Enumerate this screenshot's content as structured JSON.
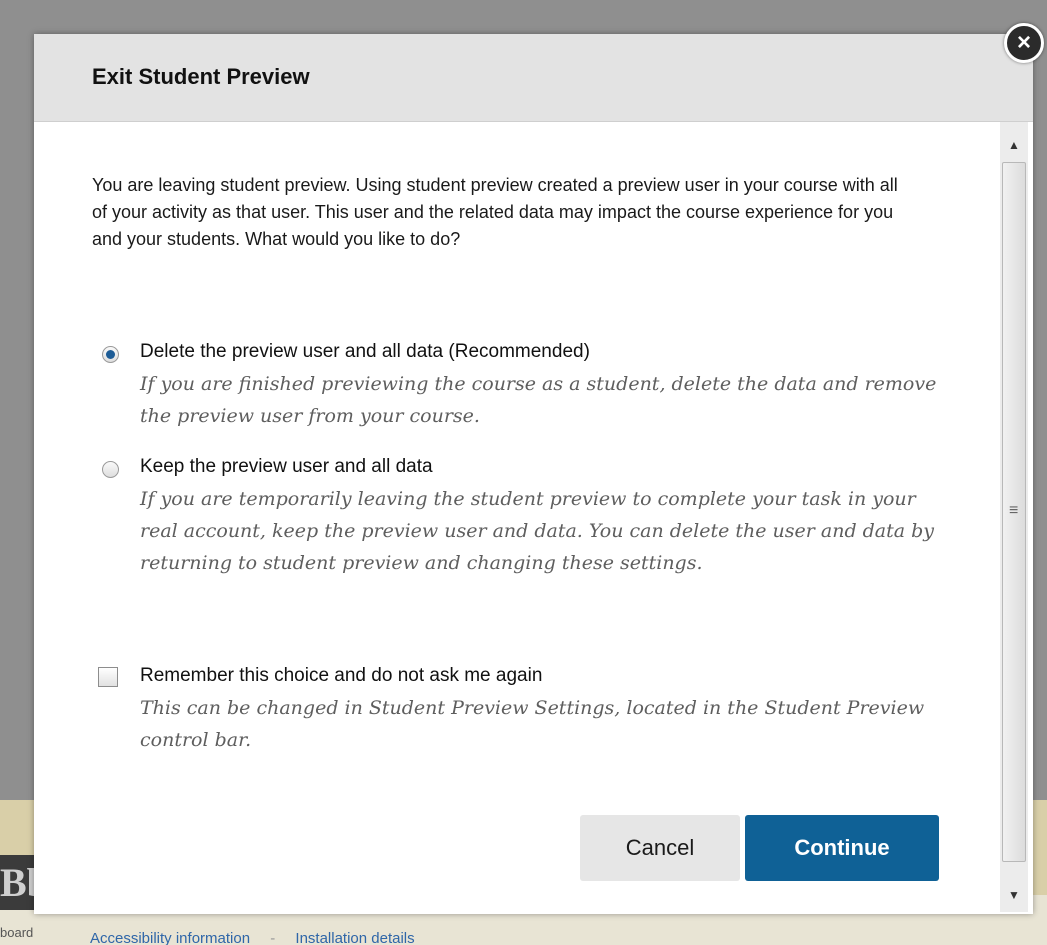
{
  "background": {
    "footer_logo": "Bb",
    "footer_left_text": "board",
    "footer_links": [
      "Accessibility information",
      "Installation details"
    ]
  },
  "dialog": {
    "title": "Exit Student Preview",
    "close_icon": "close-icon",
    "intro": "You are leaving student preview. Using student preview created a preview user in your course with all of your activity as that user. This user and the related data may impact the course experience for you and your students. What would you like to do?",
    "options": [
      {
        "label": "Delete the preview user and all data (Recommended)",
        "description": "If you are finished previewing the course as a student, delete the data and remove the preview user from your course.",
        "selected": true
      },
      {
        "label": "Keep the preview user and all data",
        "description": "If you are temporarily leaving the student preview to complete your task in your real account, keep the preview user and data. You can delete the user and data by returning to student preview and changing these settings.",
        "selected": false
      }
    ],
    "remember": {
      "label": "Remember this choice and do not ask me again",
      "description": "This can be changed in Student Preview Settings, located in the Student Preview control bar.",
      "checked": false
    },
    "buttons": {
      "cancel": "Cancel",
      "continue": "Continue"
    }
  },
  "colors": {
    "accent": "#0f6196",
    "header_bg": "#e3e3e3",
    "description_text": "#5e5e5e"
  }
}
